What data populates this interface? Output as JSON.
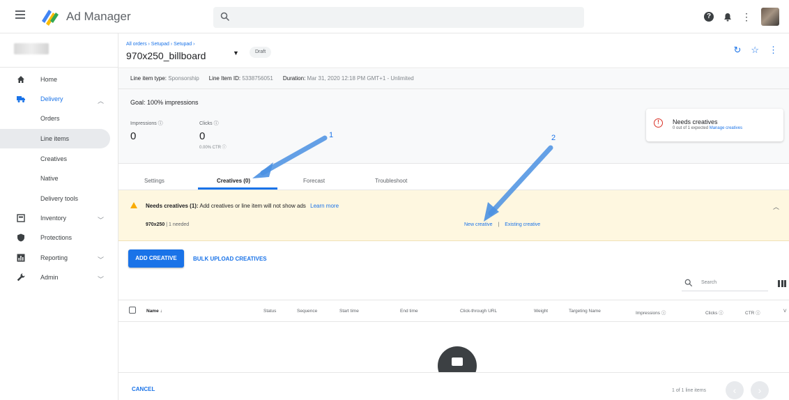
{
  "app": {
    "title": "Ad Manager"
  },
  "header": {
    "breadcrumb": "All orders › Setupad › Setupad ›",
    "title": "970x250_billboard",
    "status": "Draft"
  },
  "sidebar": {
    "items": [
      {
        "label": "Home"
      },
      {
        "label": "Delivery"
      },
      {
        "label": "Orders"
      },
      {
        "label": "Line items"
      },
      {
        "label": "Creatives"
      },
      {
        "label": "Native"
      },
      {
        "label": "Delivery tools"
      },
      {
        "label": "Inventory"
      },
      {
        "label": "Protections"
      },
      {
        "label": "Reporting"
      },
      {
        "label": "Admin"
      }
    ]
  },
  "meta": {
    "type_label": "Line item type:",
    "type_value": "Sponsorship",
    "id_label": "Line Item ID:",
    "id_value": "5338756051",
    "duration_label": "Duration:",
    "duration_value": "Mar 31, 2020 12:18 PM GMT+1 - Unlimited"
  },
  "goal": "Goal: 100% impressions",
  "stats": {
    "impressions_label": "Impressions ⓘ",
    "impressions_value": "0",
    "clicks_label": "Clicks ⓘ",
    "clicks_value": "0",
    "ctr": "0.00% CTR ⓘ"
  },
  "alert": {
    "title": "Needs creatives",
    "subtitle": "0 out of 1 expected",
    "link": "Manage creatives"
  },
  "tabs": [
    {
      "label": "Settings"
    },
    {
      "label": "Creatives (0)"
    },
    {
      "label": "Forecast"
    },
    {
      "label": "Troubleshoot"
    }
  ],
  "warning": {
    "title_bold": "Needs creatives (1):",
    "title_rest": "Add creatives or line item will not show ads",
    "learn_more": "Learn more",
    "size": "970x250",
    "size_needed": "| 1 needed",
    "new_creative": "New creative",
    "separator": "|",
    "existing_creative": "Existing creative"
  },
  "actions": {
    "add_creative": "ADD CREATIVE",
    "bulk_upload": "BULK UPLOAD CREATIVES"
  },
  "table": {
    "search_placeholder": "Search",
    "columns": [
      "Name ↓",
      "Status",
      "Sequence",
      "Start time",
      "End time",
      "Click-through URL",
      "Weight",
      "Targeting Name",
      "Impressions ⓘ",
      "Clicks ⓘ",
      "CTR ⓘ",
      "V"
    ]
  },
  "footer": {
    "cancel": "CANCEL",
    "pager": "1 of 1 line items"
  },
  "annotations": {
    "arrow1": "1",
    "arrow2": "2"
  },
  "colors": {
    "accent": "#1a73e8",
    "warning_bg": "#fef7e0",
    "error": "#d93025"
  }
}
